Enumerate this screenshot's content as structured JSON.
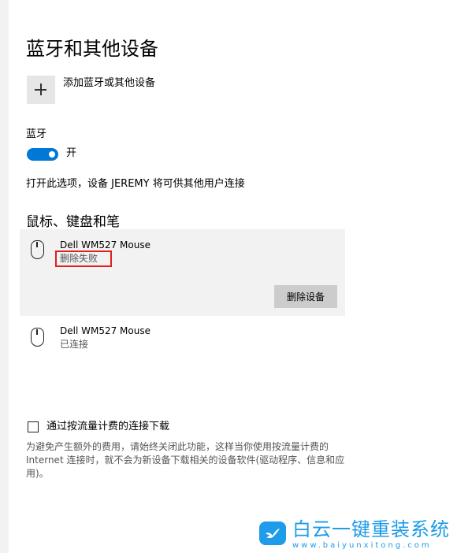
{
  "page": {
    "title": "蓝牙和其他设备"
  },
  "add_device": {
    "label": "添加蓝牙或其他设备",
    "icon": "plus-icon"
  },
  "bluetooth": {
    "label": "蓝牙",
    "toggle_on": true,
    "state_label": "开",
    "accent_color": "#0078d7",
    "discoverable_text": "打开此选项，设备 JEREMY 将可供其他用户连接"
  },
  "mouse_section": {
    "title": "鼠标、键盘和笔",
    "devices": [
      {
        "name": "Dell WM527 Mouse",
        "status": "删除失败",
        "selected": true,
        "icon": "mouse-icon",
        "action_label": "删除设备"
      },
      {
        "name": "Dell WM527 Mouse",
        "status": "已连接",
        "selected": false,
        "icon": "mouse-icon"
      }
    ],
    "highlight_color": "#e0201c"
  },
  "metered": {
    "checked": false,
    "label": "通过按流量计费的连接下载",
    "description": "为避免产生额外的费用，请始终关闭此功能，这样当你使用按流量计费的 Internet 连接时，就不会为新设备下载相关的设备软件(驱动程序、信息和应用)。"
  },
  "watermark": {
    "title": "白云一键重装系统",
    "url": "www.baiyunxitong.com",
    "icon": "bird-logo-icon",
    "color": "#1e9be9"
  }
}
